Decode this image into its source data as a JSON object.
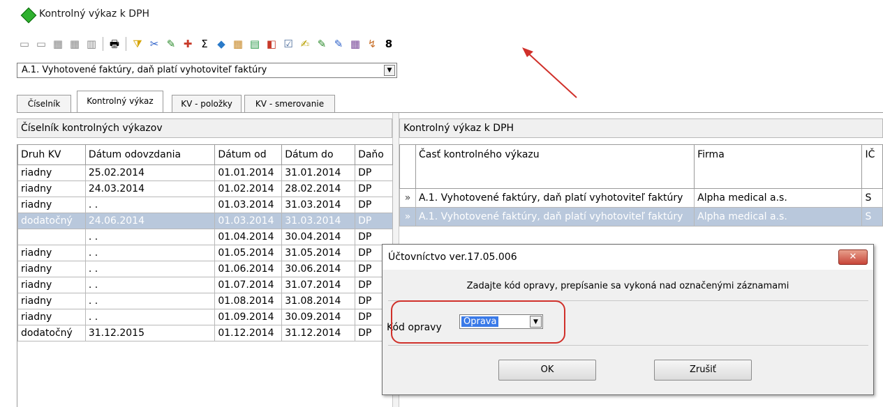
{
  "window": {
    "title": "Kontrolný výkaz k DPH"
  },
  "toolbar": {
    "icons": [
      "▭",
      "▭",
      "▦",
      "▦",
      "▥",
      "🖶",
      "⧩",
      "✂",
      "✎",
      "✚",
      "Σ",
      "◆",
      "▦",
      "▤",
      "◧",
      "☑",
      "✍",
      "✎",
      "✎",
      "▦",
      "↯",
      "8"
    ]
  },
  "section_select": {
    "value": "A.1. Vyhotovené faktúry, daň platí vyhotoviteľ faktúry"
  },
  "tabs": [
    {
      "label": "Číselník"
    },
    {
      "label": "Kontrolný výkaz"
    },
    {
      "label": "KV - položky"
    },
    {
      "label": "KV - smerovanie"
    }
  ],
  "left_panel": {
    "title": "Číselník kontrolných výkazov",
    "columns": [
      "Druh KV",
      "Dátum odovzdania",
      "Dátum od",
      "Dátum do",
      "Daňo"
    ],
    "rows": [
      [
        "riadny",
        "25.02.2014",
        "01.01.2014",
        "31.01.2014",
        "DP"
      ],
      [
        "riadny",
        "24.03.2014",
        "01.02.2014",
        "28.02.2014",
        "DP"
      ],
      [
        "riadny",
        " . .",
        "01.03.2014",
        "31.03.2014",
        "DP"
      ],
      [
        "dodatočný",
        "24.06.2014",
        "01.03.2014",
        "31.03.2014",
        "DP"
      ],
      [
        "",
        " . .",
        "01.04.2014",
        "30.04.2014",
        "DP"
      ],
      [
        "riadny",
        " . .",
        "01.05.2014",
        "31.05.2014",
        "DP"
      ],
      [
        "riadny",
        " . .",
        "01.06.2014",
        "30.06.2014",
        "DP"
      ],
      [
        "riadny",
        " . .",
        "01.07.2014",
        "31.07.2014",
        "DP"
      ],
      [
        "riadny",
        " . .",
        "01.08.2014",
        "31.08.2014",
        "DP"
      ],
      [
        "riadny",
        " . .",
        "01.09.2014",
        "30.09.2014",
        "DP"
      ],
      [
        "dodatočný",
        "31.12.2015",
        "01.12.2014",
        "31.12.2014",
        "DP"
      ]
    ],
    "selected_row": 3
  },
  "right_panel": {
    "title": "Kontrolný výkaz k DPH",
    "columns": [
      "",
      "Časť kontrolného výkazu",
      "Firma",
      "IČ"
    ],
    "rows": [
      [
        "»",
        "A.1. Vyhotovené faktúry, daň platí vyhotoviteľ faktúry",
        "Alpha medical a.s.",
        "S"
      ],
      [
        "»",
        "A.1. Vyhotovené faktúry, daň platí vyhotoviteľ faktúry",
        "Alpha medical a.s.",
        "S"
      ]
    ],
    "selected_row": 1
  },
  "dialog": {
    "title": "Účtovníctvo ver.17.05.006",
    "close_label": "✕",
    "message": "Zadajte kód opravy, prepísanie sa vykoná nad označenými záznamami",
    "code_label": "Kód opravy",
    "code_value": "Oprava",
    "ok_label": "OK",
    "cancel_label": "Zrušiť"
  },
  "colors": {
    "selection_row": "#b9c8dc",
    "highlight": "#3a7ae8",
    "annotation_red": "#d0302a"
  }
}
